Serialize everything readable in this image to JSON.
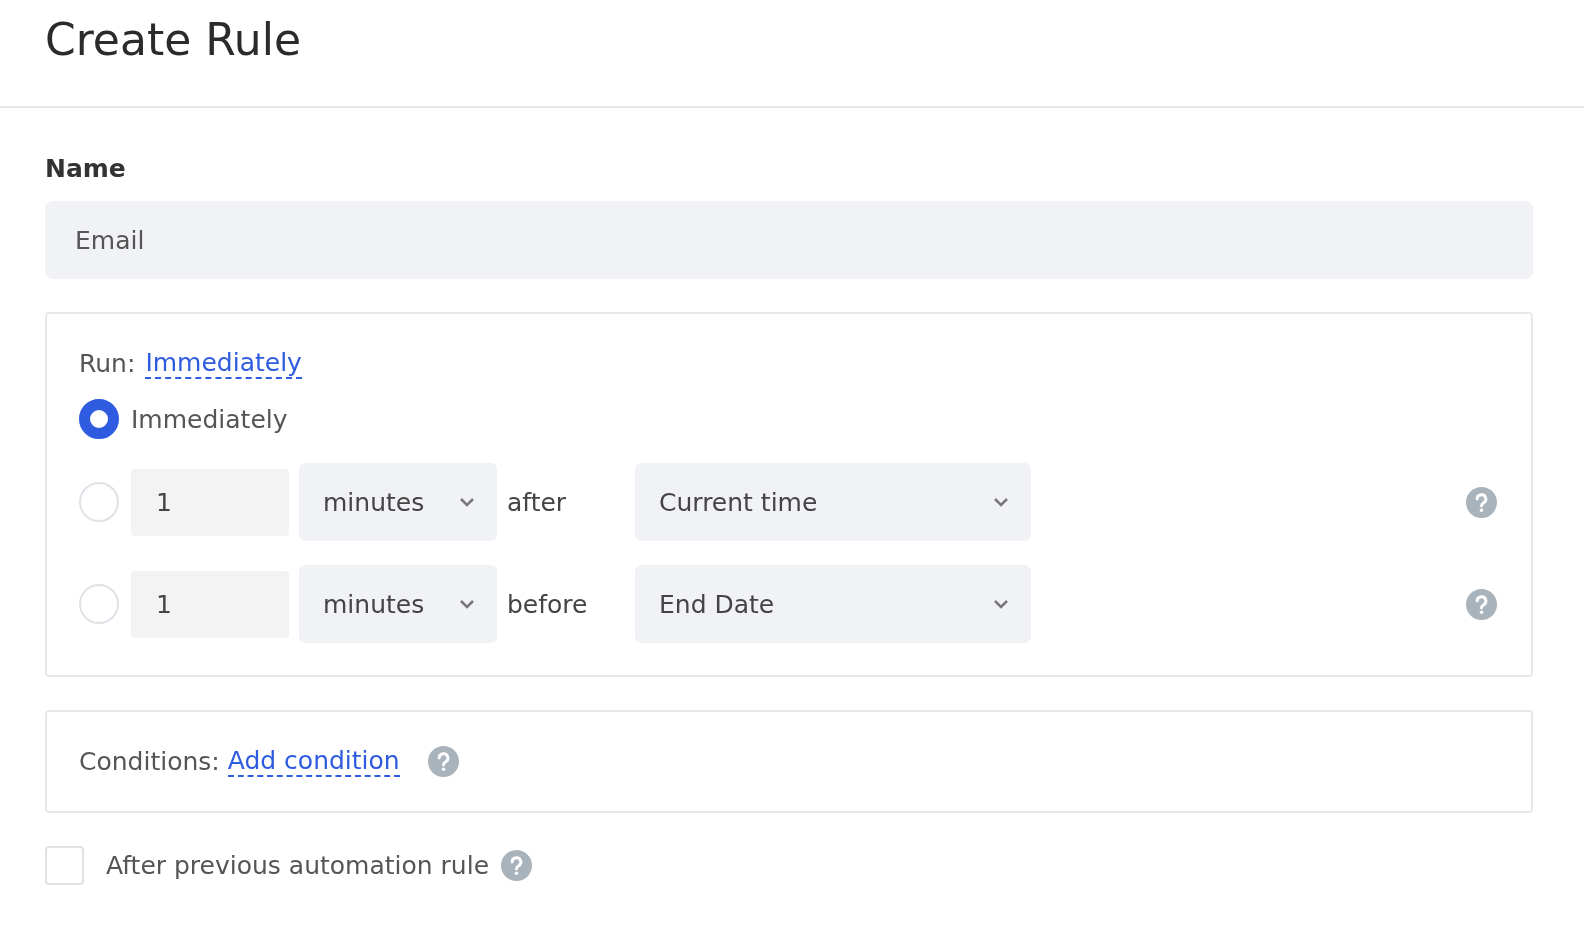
{
  "title": "Create Rule",
  "name_field": {
    "label": "Name",
    "value": "Email"
  },
  "run": {
    "label": "Run:",
    "link": "Immediately",
    "options": [
      {
        "kind": "immediate",
        "label": "Immediately",
        "selected": true
      },
      {
        "kind": "offset",
        "selected": false,
        "amount": "1",
        "unit": "minutes",
        "relation": "after",
        "reference": "Current time"
      },
      {
        "kind": "offset",
        "selected": false,
        "amount": "1",
        "unit": "minutes",
        "relation": "before",
        "reference": "End Date"
      }
    ]
  },
  "conditions": {
    "label": "Conditions:",
    "link": "Add condition"
  },
  "after_previous": {
    "label": "After previous automation rule",
    "checked": false
  }
}
